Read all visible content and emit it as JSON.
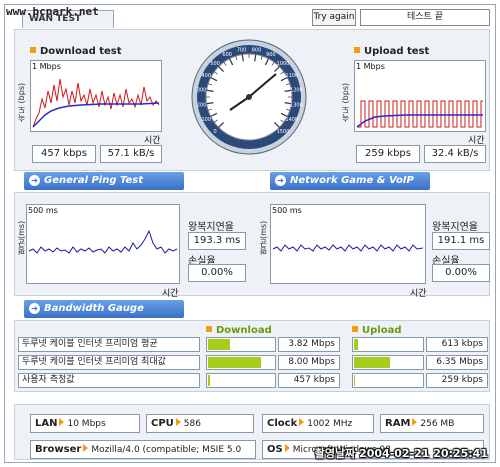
{
  "watermark": "www.bcpark.net",
  "header": {
    "tab_title": "WAN TEST",
    "try_again": "Try again",
    "test_text": "테스트 끝"
  },
  "download": {
    "title": "Download test",
    "axis": "속도 (bps)",
    "scale": "1 Mbps",
    "time_label": "시간",
    "speed_kbps": "457 kbps",
    "speed_kbs": "57.1 kB/s"
  },
  "upload": {
    "title": "Upload test",
    "axis": "속도 (bps)",
    "scale": "1 Mbps",
    "time_label": "시간",
    "speed_kbps": "259 kbps",
    "speed_kbs": "32.4 kB/s"
  },
  "speedometer": {
    "ticks": [
      "0",
      "100",
      "200",
      "300",
      "400",
      "500",
      "600",
      "700",
      "800",
      "900",
      "1000",
      "1100",
      "1200",
      "1300",
      "1400",
      "1500"
    ]
  },
  "sections": {
    "ping": "General Ping Test",
    "game": "Network Game & VoIP Test",
    "bandwidth": "Bandwidth Gauge"
  },
  "ping": {
    "axis": "평균(ms)",
    "scale": "500 ms",
    "time_label": "시간",
    "rtt_label": "왕복지연율",
    "rtt_value": "193.3 ms",
    "loss_label": "손실율",
    "loss_value": "0.00%"
  },
  "game": {
    "axis": "평균(ms)",
    "scale": "500 ms",
    "time_label": "시간",
    "rtt_label": "왕복지연율",
    "rtt_value": "191.1 ms",
    "loss_label": "손실율",
    "loss_value": "0.00%"
  },
  "bandwidth": {
    "download_label": "Download",
    "upload_label": "Upload",
    "rows": [
      {
        "label": "두루넷 케이블 인터넷 프리미엄 평균",
        "down": "3.82 Mbps",
        "down_frac": 0.33,
        "up": "613 kbps",
        "up_frac": 0.05
      },
      {
        "label": "두루넷 케이블 인터넷 프리미엄 최대값",
        "down": "8.00 Mbps",
        "down_frac": 0.78,
        "up": "6.35 Mbps",
        "up_frac": 0.52
      },
      {
        "label": "사용자 측정값",
        "down": "457 kbps",
        "down_frac": 0.03,
        "up": "259 kbps",
        "up_frac": 0.02
      }
    ]
  },
  "system": {
    "lan_label": "LAN",
    "lan_value": "10 Mbps",
    "cpu_label": "CPU",
    "cpu_value": "586",
    "clock_label": "Clock",
    "clock_value": "1002 MHz",
    "ram_label": "RAM",
    "ram_value": "256 MB",
    "browser_label": "Browser",
    "browser_value": "Mozilla/4.0 (compatible; MSIE 5.0",
    "os_label": "OS",
    "os_value": "Microsoft Windows 98"
  },
  "timestamp": "촬영날짜 2004-02-21 20:25:41"
}
